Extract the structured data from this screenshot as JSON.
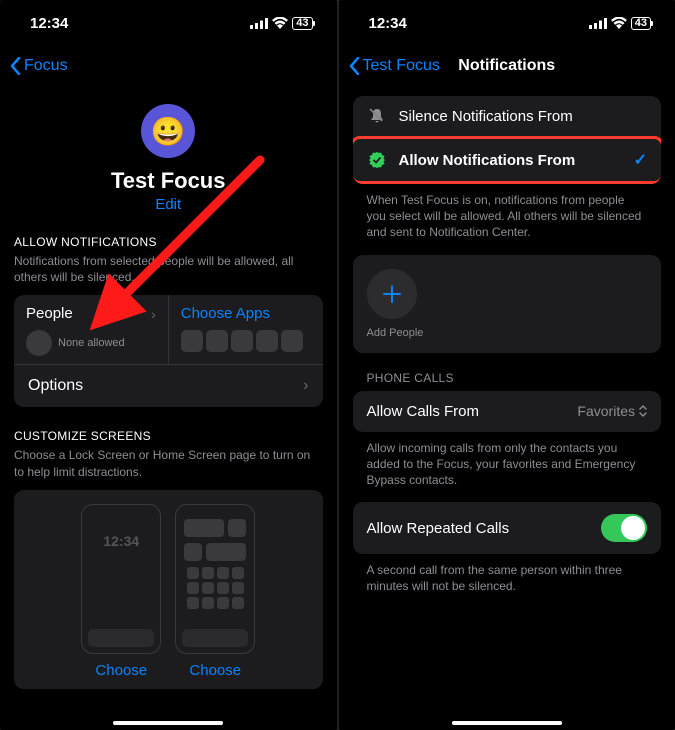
{
  "status": {
    "time": "12:34",
    "battery": "43"
  },
  "left": {
    "back": "Focus",
    "title": "Test Focus",
    "edit": "Edit",
    "allow_header": "ALLOW NOTIFICATIONS",
    "allow_desc": "Notifications from selected people will be allowed, all others will be silenced.",
    "people": "People",
    "choose_apps": "Choose Apps",
    "none_allowed": "None allowed",
    "options": "Options",
    "customize_header": "CUSTOMIZE SCREENS",
    "customize_desc": "Choose a Lock Screen or Home Screen page to turn on to help limit distractions.",
    "prev_time": "12:34",
    "choose": "Choose"
  },
  "right": {
    "back": "Test Focus",
    "title": "Notifications",
    "silence": "Silence Notifications From",
    "allow": "Allow Notifications From",
    "when_desc": "When Test Focus is on, notifications from people you select will be allowed. All others will be silenced and sent to Notification Center.",
    "add_people": "Add People",
    "phone_calls": "PHONE CALLS",
    "allow_calls": "Allow Calls From",
    "favorites": "Favorites",
    "calls_desc": "Allow incoming calls from only the contacts you added to the Focus, your favorites and Emergency Bypass contacts.",
    "repeated": "Allow Repeated Calls",
    "repeated_desc": "A second call from the same person within three minutes will not be silenced."
  }
}
